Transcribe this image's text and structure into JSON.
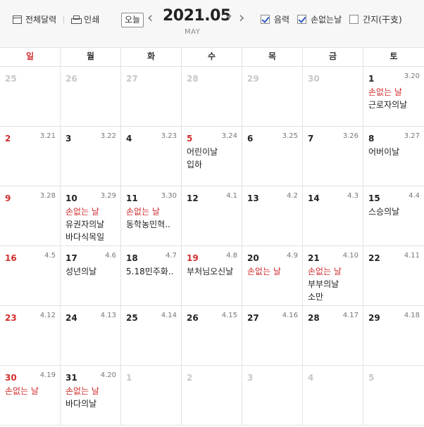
{
  "toolbar": {
    "full_calendar_label": "전체달력",
    "print_label": "인쇄",
    "today_label": "오늘",
    "prev_arrow": "‹",
    "next_arrow": "›",
    "year_month": "2021.05",
    "month_en": "MAY",
    "options": [
      {
        "label": "음력",
        "checked": true
      },
      {
        "label": "손없는날",
        "checked": true
      },
      {
        "label": "간지(干支)",
        "checked": false
      }
    ]
  },
  "weekdays": [
    "일",
    "월",
    "화",
    "수",
    "목",
    "금",
    "토"
  ],
  "weeks": [
    [
      {
        "day": "25",
        "other": true,
        "lunar": "",
        "events": []
      },
      {
        "day": "26",
        "other": true,
        "lunar": "",
        "events": []
      },
      {
        "day": "27",
        "other": true,
        "lunar": "",
        "events": []
      },
      {
        "day": "28",
        "other": true,
        "lunar": "",
        "events": []
      },
      {
        "day": "29",
        "other": true,
        "lunar": "",
        "events": []
      },
      {
        "day": "30",
        "other": true,
        "lunar": "",
        "events": []
      },
      {
        "day": "1",
        "other": false,
        "lunar": "3.20",
        "events": [
          {
            "text": "손없는 날",
            "kind": "lucky"
          },
          {
            "text": "근로자의날",
            "kind": "holiday"
          }
        ]
      }
    ],
    [
      {
        "day": "2",
        "other": false,
        "lunar": "3.21",
        "events": []
      },
      {
        "day": "3",
        "other": false,
        "lunar": "3.22",
        "events": []
      },
      {
        "day": "4",
        "other": false,
        "lunar": "3.23",
        "events": []
      },
      {
        "day": "5",
        "other": false,
        "red": true,
        "lunar": "3.24",
        "events": [
          {
            "text": "어린이날",
            "kind": "holiday"
          },
          {
            "text": "입하",
            "kind": "holiday"
          }
        ]
      },
      {
        "day": "6",
        "other": false,
        "lunar": "3.25",
        "events": []
      },
      {
        "day": "7",
        "other": false,
        "lunar": "3.26",
        "events": []
      },
      {
        "day": "8",
        "other": false,
        "lunar": "3.27",
        "events": [
          {
            "text": "어버이날",
            "kind": "holiday"
          }
        ]
      }
    ],
    [
      {
        "day": "9",
        "other": false,
        "lunar": "3.28",
        "events": []
      },
      {
        "day": "10",
        "other": false,
        "lunar": "3.29",
        "events": [
          {
            "text": "손없는 날",
            "kind": "lucky"
          },
          {
            "text": "유권자의날",
            "kind": "holiday"
          },
          {
            "text": "바다식목일",
            "kind": "holiday"
          }
        ]
      },
      {
        "day": "11",
        "other": false,
        "lunar": "3.30",
        "events": [
          {
            "text": "손없는 날",
            "kind": "lucky"
          },
          {
            "text": "동학농민혁..",
            "kind": "holiday"
          }
        ]
      },
      {
        "day": "12",
        "other": false,
        "lunar": "4.1",
        "events": []
      },
      {
        "day": "13",
        "other": false,
        "lunar": "4.2",
        "events": []
      },
      {
        "day": "14",
        "other": false,
        "lunar": "4.3",
        "events": []
      },
      {
        "day": "15",
        "other": false,
        "lunar": "4.4",
        "events": [
          {
            "text": "스승의날",
            "kind": "holiday"
          }
        ]
      }
    ],
    [
      {
        "day": "16",
        "other": false,
        "lunar": "4.5",
        "events": []
      },
      {
        "day": "17",
        "other": false,
        "lunar": "4.6",
        "events": [
          {
            "text": "성년의날",
            "kind": "holiday"
          }
        ]
      },
      {
        "day": "18",
        "other": false,
        "lunar": "4.7",
        "events": [
          {
            "text": "5.18민주화..",
            "kind": "holiday"
          }
        ]
      },
      {
        "day": "19",
        "other": false,
        "red": true,
        "lunar": "4.8",
        "events": [
          {
            "text": "부처님오신날",
            "kind": "holiday"
          }
        ]
      },
      {
        "day": "20",
        "other": false,
        "lunar": "4.9",
        "events": [
          {
            "text": "손없는 날",
            "kind": "lucky"
          }
        ]
      },
      {
        "day": "21",
        "other": false,
        "lunar": "4.10",
        "events": [
          {
            "text": "손없는 날",
            "kind": "lucky"
          },
          {
            "text": "부부의날",
            "kind": "holiday"
          },
          {
            "text": "소만",
            "kind": "holiday"
          }
        ]
      },
      {
        "day": "22",
        "other": false,
        "lunar": "4.11",
        "events": []
      }
    ],
    [
      {
        "day": "23",
        "other": false,
        "lunar": "4.12",
        "events": []
      },
      {
        "day": "24",
        "other": false,
        "lunar": "4.13",
        "events": []
      },
      {
        "day": "25",
        "other": false,
        "lunar": "4.14",
        "events": []
      },
      {
        "day": "26",
        "other": false,
        "lunar": "4.15",
        "events": []
      },
      {
        "day": "27",
        "other": false,
        "lunar": "4.16",
        "events": []
      },
      {
        "day": "28",
        "other": false,
        "lunar": "4.17",
        "events": []
      },
      {
        "day": "29",
        "other": false,
        "lunar": "4.18",
        "events": []
      }
    ],
    [
      {
        "day": "30",
        "other": false,
        "lunar": "4.19",
        "events": [
          {
            "text": "손없는 날",
            "kind": "lucky"
          }
        ]
      },
      {
        "day": "31",
        "other": false,
        "lunar": "4.20",
        "events": [
          {
            "text": "손없는 날",
            "kind": "lucky"
          },
          {
            "text": "바다의날",
            "kind": "holiday"
          }
        ]
      },
      {
        "day": "1",
        "other": true,
        "lunar": "",
        "events": []
      },
      {
        "day": "2",
        "other": true,
        "lunar": "",
        "events": []
      },
      {
        "day": "3",
        "other": true,
        "lunar": "",
        "events": []
      },
      {
        "day": "4",
        "other": true,
        "lunar": "",
        "events": []
      },
      {
        "day": "5",
        "other": true,
        "lunar": "",
        "events": []
      }
    ]
  ],
  "colors": {
    "sunday": "#d12e2e",
    "lucky_day": "#d12e2e",
    "check": "#2c5bbf"
  }
}
